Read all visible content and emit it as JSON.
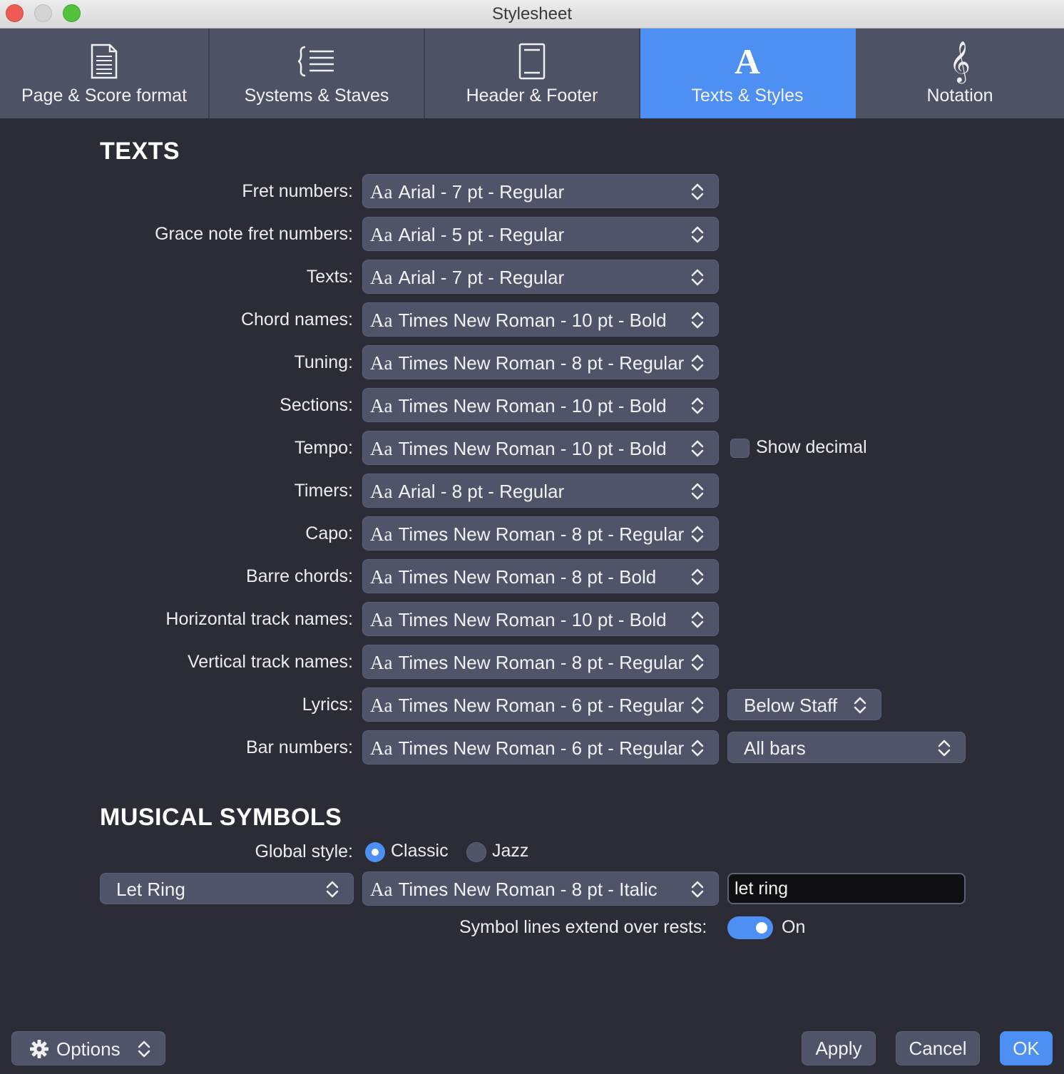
{
  "window": {
    "title": "Stylesheet"
  },
  "tabs": [
    {
      "label": "Page & Score format",
      "icon": "page-icon"
    },
    {
      "label": "Systems & Staves",
      "icon": "staves-icon"
    },
    {
      "label": "Header & Footer",
      "icon": "header-footer-icon"
    },
    {
      "label": "Texts & Styles",
      "icon": "text-style-icon",
      "active": true
    },
    {
      "label": "Notation",
      "icon": "treble-clef-icon"
    }
  ],
  "texts_section": {
    "title": "TEXTS",
    "font_prefix": "Aa",
    "rows": [
      {
        "label": "Fret numbers:",
        "value": "Arial - 7 pt - Regular"
      },
      {
        "label": "Grace note fret numbers:",
        "value": "Arial - 5 pt - Regular"
      },
      {
        "label": "Texts:",
        "value": "Arial - 7 pt - Regular"
      },
      {
        "label": "Chord names:",
        "value": "Times New Roman - 10 pt - Bold"
      },
      {
        "label": "Tuning:",
        "value": "Times New Roman - 8 pt - Regular"
      },
      {
        "label": "Sections:",
        "value": "Times New Roman - 10 pt - Bold"
      },
      {
        "label": "Tempo:",
        "value": "Times New Roman - 10 pt - Bold"
      },
      {
        "label": "Timers:",
        "value": "Arial - 8 pt - Regular"
      },
      {
        "label": "Capo:",
        "value": "Times New Roman - 8 pt - Regular"
      },
      {
        "label": "Barre chords:",
        "value": "Times New Roman - 8 pt - Bold"
      },
      {
        "label": "Horizontal track names:",
        "value": "Times New Roman - 10 pt - Bold"
      },
      {
        "label": "Vertical track names:",
        "value": "Times New Roman - 8 pt - Regular"
      },
      {
        "label": "Lyrics:",
        "value": "Times New Roman - 6 pt - Regular"
      },
      {
        "label": "Bar numbers:",
        "value": "Times New Roman - 6 pt - Regular"
      }
    ],
    "show_decimal": {
      "label": "Show decimal",
      "checked": false
    },
    "lyrics_position": "Below Staff",
    "bar_numbers_mode": "All bars"
  },
  "symbols_section": {
    "title": "MUSICAL SYMBOLS",
    "global_style_label": "Global style:",
    "styles": [
      {
        "label": "Classic",
        "selected": true
      },
      {
        "label": "Jazz",
        "selected": false
      }
    ],
    "symbol_select": "Let Ring",
    "symbol_font": "Times New Roman - 8 pt - Italic",
    "symbol_text": "let ring",
    "extend_label": "Symbol lines extend over rests:",
    "extend_state": "On"
  },
  "footer": {
    "options_label": "Options",
    "apply_label": "Apply",
    "cancel_label": "Cancel",
    "ok_label": "OK"
  },
  "colors": {
    "background": "#2b2c36",
    "tab_bar": "#4d5265",
    "accent": "#4d8ff2",
    "control": "#4f5468"
  }
}
